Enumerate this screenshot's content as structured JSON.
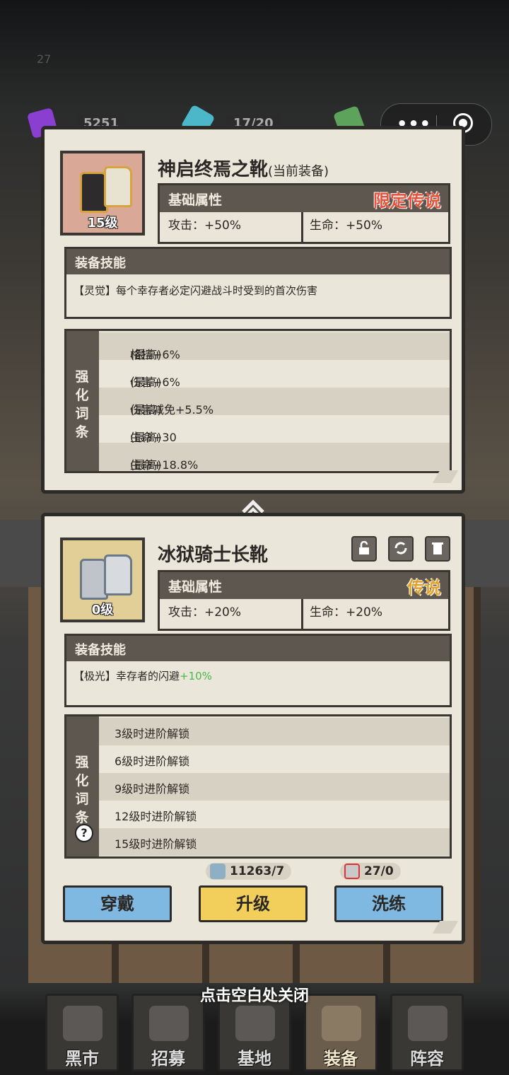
{
  "status_number": "27",
  "resources": {
    "r1": "5251",
    "r2": "17/20"
  },
  "current": {
    "name": "神启终焉之靴",
    "tag": "(当前装备)",
    "level": "15级",
    "base_label": "基础属性",
    "rarity": "限定传说",
    "attack": "攻击：+50%",
    "hp": "生命：+50%",
    "skill_header": "装备技能",
    "skill_text": "【灵觉】每个幸存者必定闪避战斗时受到的首次伤害",
    "affix_label": "强化词条",
    "affixes": [
      {
        "text": "格挡+6%",
        "note": "(最高)"
      },
      {
        "text": "伤害+6%",
        "note": "(最高)"
      },
      {
        "text": "伤害减免+5.5%",
        "note": "(最高)"
      },
      {
        "text": "生命+30",
        "note": "(最高)"
      },
      {
        "text": "生命+18.8%",
        "note": "(最高)"
      }
    ]
  },
  "new_item": {
    "name": "冰狱骑士长靴",
    "level": "0级",
    "base_label": "基础属性",
    "rarity": "传说",
    "attack": "攻击：+20%",
    "hp": "生命：+20%",
    "skill_header": "装备技能",
    "skill_text": "【极光】幸存者的闪避",
    "skill_bonus": "+10%",
    "affix_label": "强化词条",
    "help": "?",
    "affixes": [
      "3级时进阶解锁",
      "6级时进阶解锁",
      "9级时进阶解锁",
      "12级时进阶解锁",
      "15级时进阶解锁"
    ],
    "cost1": "11263/7",
    "cost2": "27/0",
    "btn_equip": "穿戴",
    "btn_upgrade": "升级",
    "btn_reforge": "洗练"
  },
  "close_hint": "点击空白处关闭",
  "nav": [
    "黑市",
    "招募",
    "基地",
    "装备",
    "阵容"
  ],
  "colors": {
    "rarity_limited": "#e8513a",
    "rarity_legend": "#d98a1c",
    "green": "#47b84a",
    "btn_blue": "#7fb8e0",
    "btn_yellow": "#f2cf5b"
  }
}
